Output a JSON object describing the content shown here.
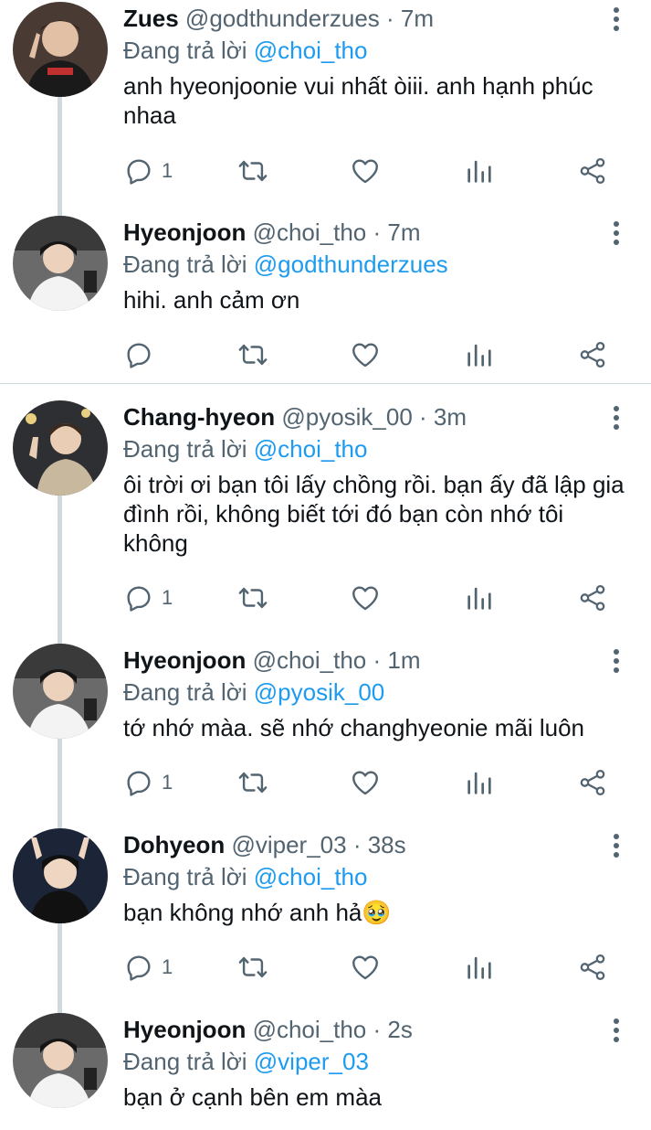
{
  "tweets": [
    {
      "name": "Zues",
      "handle": "@godthunderzues · 7m",
      "reply_prefix": "Đang trả lời ",
      "reply_to": "@choi_tho",
      "text": "anh hyeonjoonie vui nhất òiii. anh hạnh phúc nhaa",
      "reply_count": "1"
    },
    {
      "name": "Hyeonjoon",
      "handle": "@choi_tho · 7m",
      "reply_prefix": "Đang trả lời ",
      "reply_to": "@godthunderzues",
      "text": "hihi. anh cảm ơn",
      "reply_count": ""
    },
    {
      "name": "Chang-hyeon",
      "handle": "@pyosik_00 · 3m",
      "reply_prefix": "Đang trả lời ",
      "reply_to": "@choi_tho",
      "text": "ôi trời ơi bạn tôi lấy chồng rồi. bạn ấy đã lập gia đình rồi, không biết tới đó bạn còn nhớ tôi không",
      "reply_count": "1"
    },
    {
      "name": "Hyeonjoon",
      "handle": "@choi_tho · 1m",
      "reply_prefix": "Đang trả lời ",
      "reply_to": "@pyosik_00",
      "text": "tớ nhớ màa. sẽ nhớ changhyeonie mãi luôn",
      "reply_count": "1"
    },
    {
      "name": "Dohyeon",
      "handle": "@viper_03 · 38s",
      "reply_prefix": "Đang trả lời ",
      "reply_to": "@choi_tho",
      "text": "bạn không nhớ anh hả🥹",
      "reply_count": "1"
    },
    {
      "name": "Hyeonjoon",
      "handle": "@choi_tho · 2s",
      "reply_prefix": "Đang trả lời ",
      "reply_to": "@viper_03",
      "text": "bạn ở cạnh bên em màa",
      "reply_count": ""
    }
  ],
  "icons": {
    "reply": "reply-icon",
    "retweet": "retweet-icon",
    "like": "heart-icon",
    "views": "views-icon",
    "share": "share-icon",
    "more": "more-icon"
  },
  "colors": {
    "mention": "#1d9bf0",
    "secondary": "#536471",
    "thread_line": "#cfd9de"
  }
}
